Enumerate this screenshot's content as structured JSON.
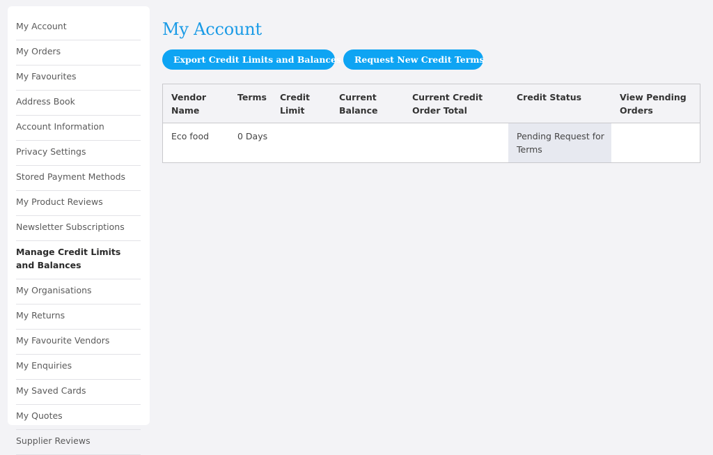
{
  "sidebar": {
    "items": [
      {
        "label": "My Account"
      },
      {
        "label": "My Orders"
      },
      {
        "label": "My Favourites"
      },
      {
        "label": "Address Book"
      },
      {
        "label": "Account Information"
      },
      {
        "label": "Privacy Settings"
      },
      {
        "label": "Stored Payment Methods"
      },
      {
        "label": "My Product Reviews"
      },
      {
        "label": "Newsletter Subscriptions"
      },
      {
        "label": "Manage Credit Limits and Balances",
        "active": true
      },
      {
        "label": "My Organisations"
      },
      {
        "label": "My Returns"
      },
      {
        "label": "My Favourite Vendors"
      },
      {
        "label": "My Enquiries"
      },
      {
        "label": "My Saved Cards"
      },
      {
        "label": "My Quotes"
      },
      {
        "label": "Supplier Reviews"
      }
    ]
  },
  "main": {
    "title": "My Account",
    "buttons": {
      "export": "Export Credit Limits and Balances",
      "request": "Request New Credit Terms"
    },
    "table": {
      "headers": [
        "Vendor Name",
        "Terms",
        "Credit Limit",
        "Current Balance",
        "Current Credit Order Total",
        "Credit Status",
        "View Pending Orders"
      ],
      "rows": [
        {
          "vendor_name": "Eco food",
          "terms": "0 Days",
          "credit_limit": "",
          "current_balance": "",
          "current_credit_order_total": "",
          "credit_status": "Pending Request for Terms",
          "view_pending_orders": ""
        }
      ]
    }
  },
  "colors": {
    "accent": "#0ea4f3",
    "title": "#1a9be6",
    "background": "#f3f3f6",
    "status_cell": "#e7e9f0"
  }
}
